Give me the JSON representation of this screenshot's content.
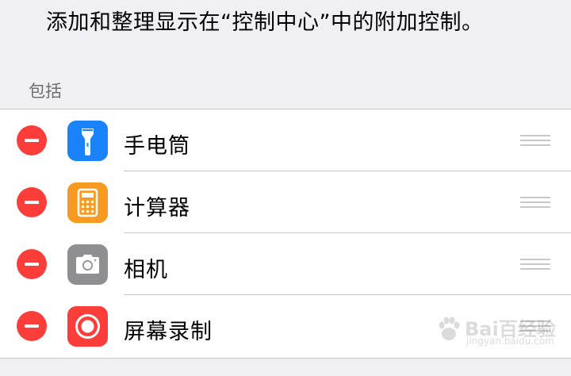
{
  "description": "添加和整理显示在“控制中心”中的附加控制。",
  "section_header": "包括",
  "items": [
    {
      "label": "手电筒",
      "icon": "flashlight-icon",
      "icon_color": "#1a82fb"
    },
    {
      "label": "计算器",
      "icon": "calculator-icon",
      "icon_color": "#f79a21"
    },
    {
      "label": "相机",
      "icon": "camera-icon",
      "icon_color": "#8e8e93"
    },
    {
      "label": "屏幕录制",
      "icon": "screen-recording-icon",
      "icon_color": "#fc3d39"
    }
  ],
  "remove_button_color": "#fc3d39",
  "watermark": {
    "brand": "Bai百经验",
    "url": "jingyan.baidu.com"
  }
}
